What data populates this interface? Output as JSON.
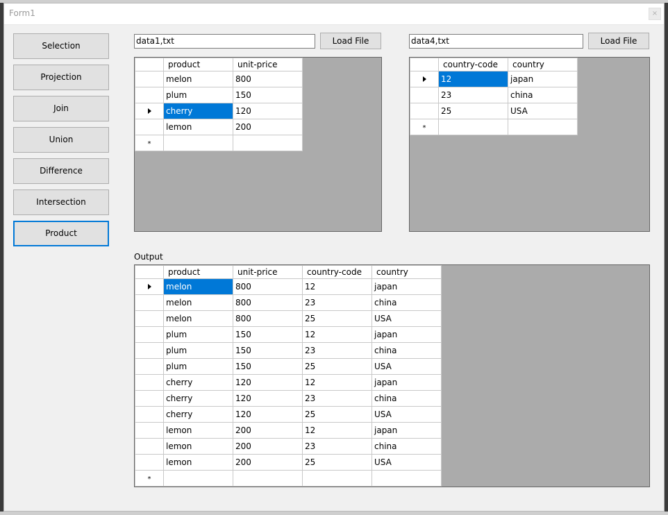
{
  "window": {
    "title": "Form1",
    "close_glyph": "×"
  },
  "sidebar": {
    "buttons": [
      {
        "label": "Selection"
      },
      {
        "label": "Projection"
      },
      {
        "label": "Join"
      },
      {
        "label": "Union"
      },
      {
        "label": "Difference"
      },
      {
        "label": "Intersection"
      },
      {
        "label": "Product"
      }
    ]
  },
  "left_panel": {
    "file_value": "data1,txt",
    "load_label": "Load File",
    "columns": [
      "product",
      "unit-price"
    ],
    "rows": [
      [
        "melon",
        "800"
      ],
      [
        "plum",
        "150"
      ],
      [
        "cherry",
        "120"
      ],
      [
        "lemon",
        "200"
      ]
    ],
    "current_row": 2,
    "selected_cell": "cherry"
  },
  "right_panel": {
    "file_value": "data4,txt",
    "load_label": "Load File",
    "columns": [
      "country-code",
      "country"
    ],
    "rows": [
      [
        "12",
        "japan"
      ],
      [
        "23",
        "china"
      ],
      [
        "25",
        "USA"
      ]
    ],
    "current_row": 0,
    "selected_cell": "12"
  },
  "output": {
    "label": "Output",
    "columns": [
      "product",
      "unit-price",
      "country-code",
      "country"
    ],
    "rows": [
      [
        "melon",
        "800",
        "12",
        "japan"
      ],
      [
        "melon",
        "800",
        "23",
        "china"
      ],
      [
        "melon",
        "800",
        "25",
        "USA"
      ],
      [
        "plum",
        "150",
        "12",
        "japan"
      ],
      [
        "plum",
        "150",
        "23",
        "china"
      ],
      [
        "plum",
        "150",
        "25",
        "USA"
      ],
      [
        "cherry",
        "120",
        "12",
        "japan"
      ],
      [
        "cherry",
        "120",
        "23",
        "china"
      ],
      [
        "cherry",
        "120",
        "25",
        "USA"
      ],
      [
        "lemon",
        "200",
        "12",
        "japan"
      ],
      [
        "lemon",
        "200",
        "23",
        "china"
      ],
      [
        "lemon",
        "200",
        "25",
        "USA"
      ]
    ],
    "current_row": 0,
    "selected_cell": "melon"
  },
  "grid_glyphs": {
    "new_row": "*"
  }
}
